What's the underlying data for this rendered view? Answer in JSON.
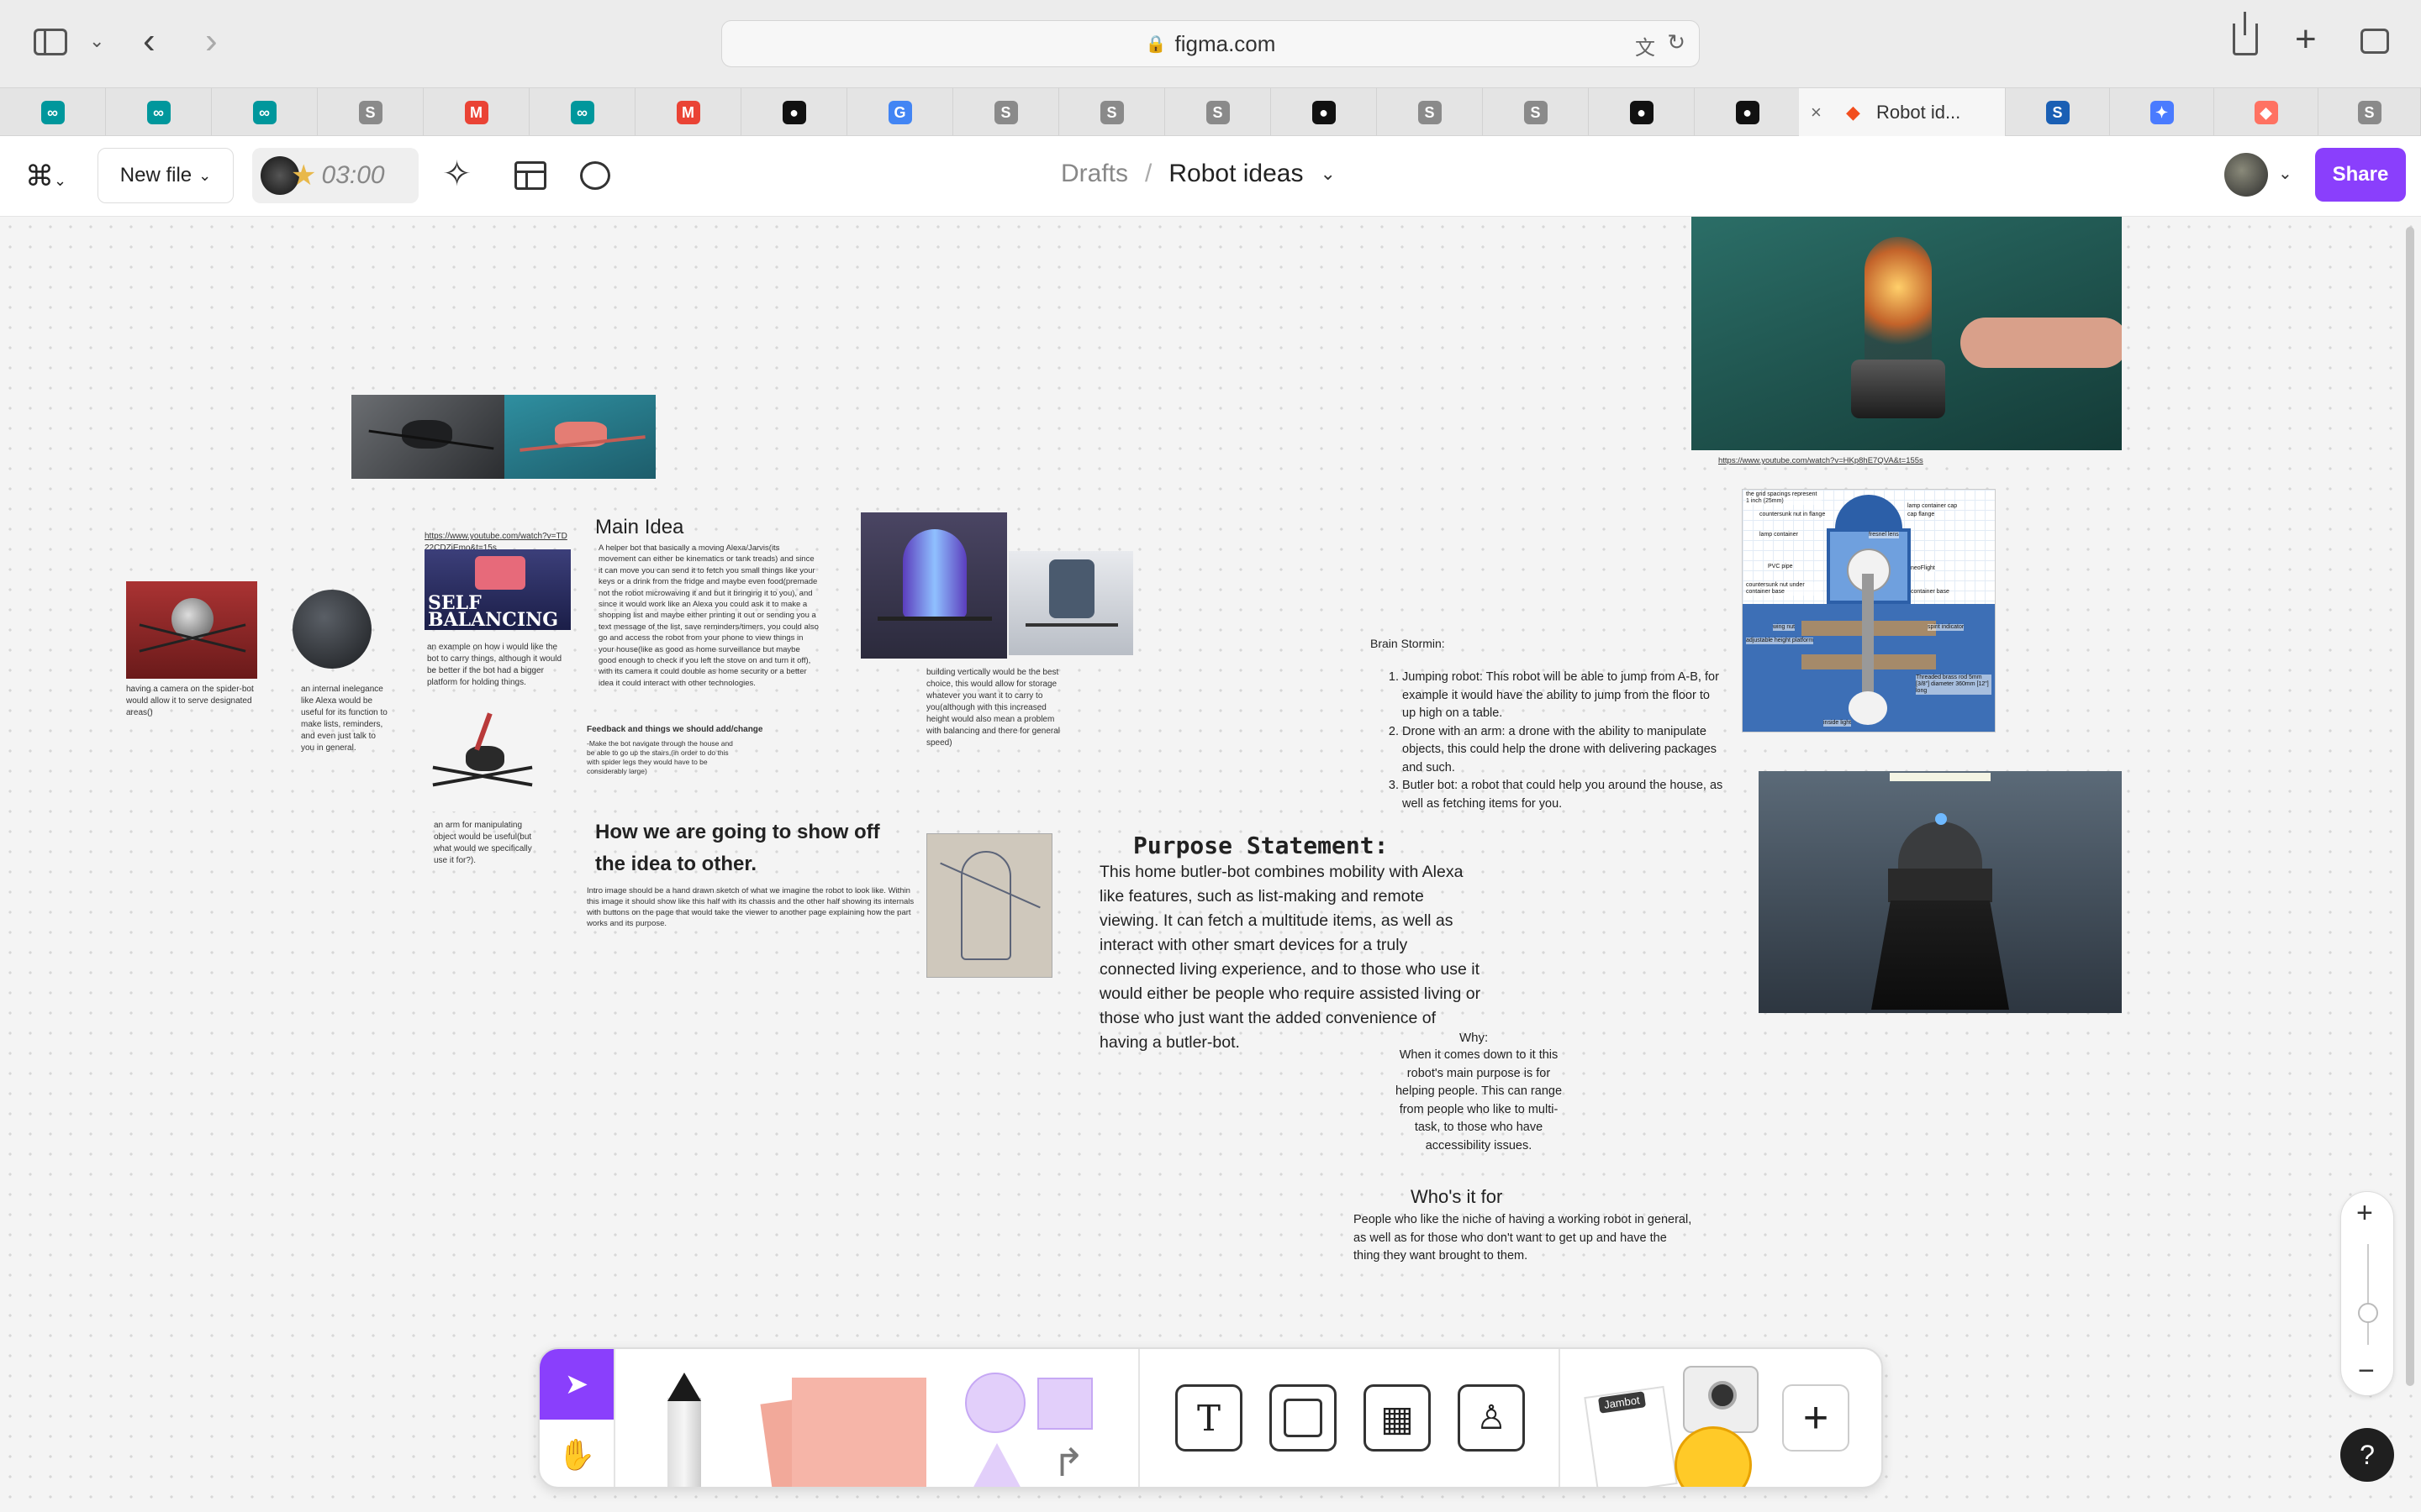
{
  "browser": {
    "url": "figma.com",
    "tabs": [
      {
        "icon": "arduino-icon",
        "color": "#00979c"
      },
      {
        "icon": "arduino-icon",
        "color": "#00979c"
      },
      {
        "icon": "arduino-icon",
        "color": "#00979c"
      },
      {
        "icon": "s-icon",
        "color": "#8a8a8a"
      },
      {
        "icon": "gmail-icon",
        "color": "#ea4335"
      },
      {
        "icon": "arduino-icon",
        "color": "#00979c"
      },
      {
        "icon": "gmail-icon",
        "color": "#ea4335"
      },
      {
        "icon": "github-icon",
        "color": "#111111"
      },
      {
        "icon": "google-icon",
        "color": "#4285f4"
      },
      {
        "icon": "s-icon",
        "color": "#8a8a8a"
      },
      {
        "icon": "s-icon",
        "color": "#8a8a8a"
      },
      {
        "icon": "s-icon",
        "color": "#8a8a8a"
      },
      {
        "icon": "github-icon",
        "color": "#111111"
      },
      {
        "icon": "s-icon",
        "color": "#8a8a8a"
      },
      {
        "icon": "s-icon",
        "color": "#8a8a8a"
      },
      {
        "icon": "github-icon",
        "color": "#111111"
      },
      {
        "icon": "github-icon",
        "color": "#111111"
      }
    ],
    "active_tab_title": "Robot id...",
    "after_tabs": [
      {
        "icon": "s-icon",
        "color": "#1a5fb4"
      },
      {
        "icon": "sparkle-icon",
        "color": "#4a7bff"
      },
      {
        "icon": "figma-icon",
        "color": "#ff7262"
      },
      {
        "icon": "s-icon",
        "color": "#8a8a8a"
      }
    ]
  },
  "figma": {
    "new_file_label": "New file",
    "timer": "03:00",
    "breadcrumb_root": "Drafts",
    "breadcrumb_sep": "/",
    "file_name": "Robot ideas",
    "share_label": "Share",
    "accent": "#8a3ffc"
  },
  "board": {
    "link1": "https://www.youtube.com/watch?v=TD22CDZiEmo&t=15s",
    "self_balancing": "SELF BALANCING",
    "caption_spider_cam": "having a camera on the spider-bot would allow it to serve designated areas()",
    "caption_alexa": "an internal inelegance like Alexa would be useful for its function to make lists, reminders, and even just talk to you in general.",
    "caption_carry": "an example on how i would like the bot to carry things, although it would be better if the bot had a bigger platform for holding things.",
    "caption_arm": "an arm for manipulating object would be useful(but what would we specifically use it for?).",
    "main_idea_title": "Main Idea",
    "main_idea_body": "A helper bot that basically a moving Alexa/Jarvis(its movement can either be kinematics or tank treads) and since it can move you can send it to fetch you small things like your keys or a drink from the fridge and maybe even food(premade not the robot microwaving it and but it bringing it to you), and since it would work like an Alexa you could ask it to make a shopping list and maybe either printing it out or sending you a text message of the list, save reminders/timers, you could also go and access the robot from your phone to view things in your house(like as good as home surveillance but maybe good enough to check if you left the stove on and turn it off), with its camera it could double as home security or a better idea it could interact with other technologies.",
    "feedback_title": "Feedback and things we should add/change",
    "feedback_body": "-Make the bot navigate through the house and be able to go up the stairs,(in order to do this with spider legs they would have to be considerably large)",
    "caption_vertical": "building vertically would be the best choice, this would allow for storage whatever you want it to carry to you(although with this increased height would also mean a problem with balancing and there for general speed)",
    "show_off_title": "How we are going to show off the idea to other.",
    "show_off_body": "Intro image should be a hand drawn sketch of what we imagine the robot to look like. Within this image it should show like this half with its chassis and the other half showing its internals with buttons on the page that would take the viewer to another page explaining how the part works and its purpose.",
    "purpose_title": "Purpose Statement:",
    "purpose_body": "This home butler-bot combines mobility with Alexa like features, such as list-making and remote viewing. It can fetch a multitude items, as well as interact with other smart devices for a truly connected living experience, and to those who use it would either be people who require assisted living or those who just want the added convenience of having a butler-bot.",
    "why_title": "Why:",
    "why_body": "When it comes down to it this robot's main purpose is for helping people.  This can range from people who like to multi-task,  to those who have accessibility issues.",
    "whos_title": "Who's it for",
    "whos_body": "People who like the niche of having a working robot in general, as well as for those who don't want to get up and have the thing they want brought to them.",
    "brain_title": "Brain Stormin:",
    "brain_items": [
      "Jumping robot:  This robot will be able to jump from A-B, for example it would have the ability to jump from the floor to up high on a table.",
      "Drone with an arm: a drone with the ability to manipulate objects, this could help the drone with delivering packages and such.",
      "Butler bot: a robot that could help you around the house, as well as fetching items for you."
    ],
    "link2": "https://www.youtube.com/watch?v=HKp8hE7QVA&t=155s",
    "diagram_labels": [
      "the grid spacings represent 1 inch (25mm)",
      "countersunk nut in flange",
      "lamp container cap",
      "cap flange",
      "lamp container",
      "fresnel lens",
      "PVC pipe",
      "neoFlight",
      "countersunk nut under container base",
      "container base",
      "wing nut",
      "spirit indicator",
      "adjustable height platform",
      "Threaded brass rod 5mm [3/8\"] diameter 360mm [12\"] long",
      "inside light"
    ]
  },
  "dock": {
    "sticker_label": "Jambot"
  }
}
